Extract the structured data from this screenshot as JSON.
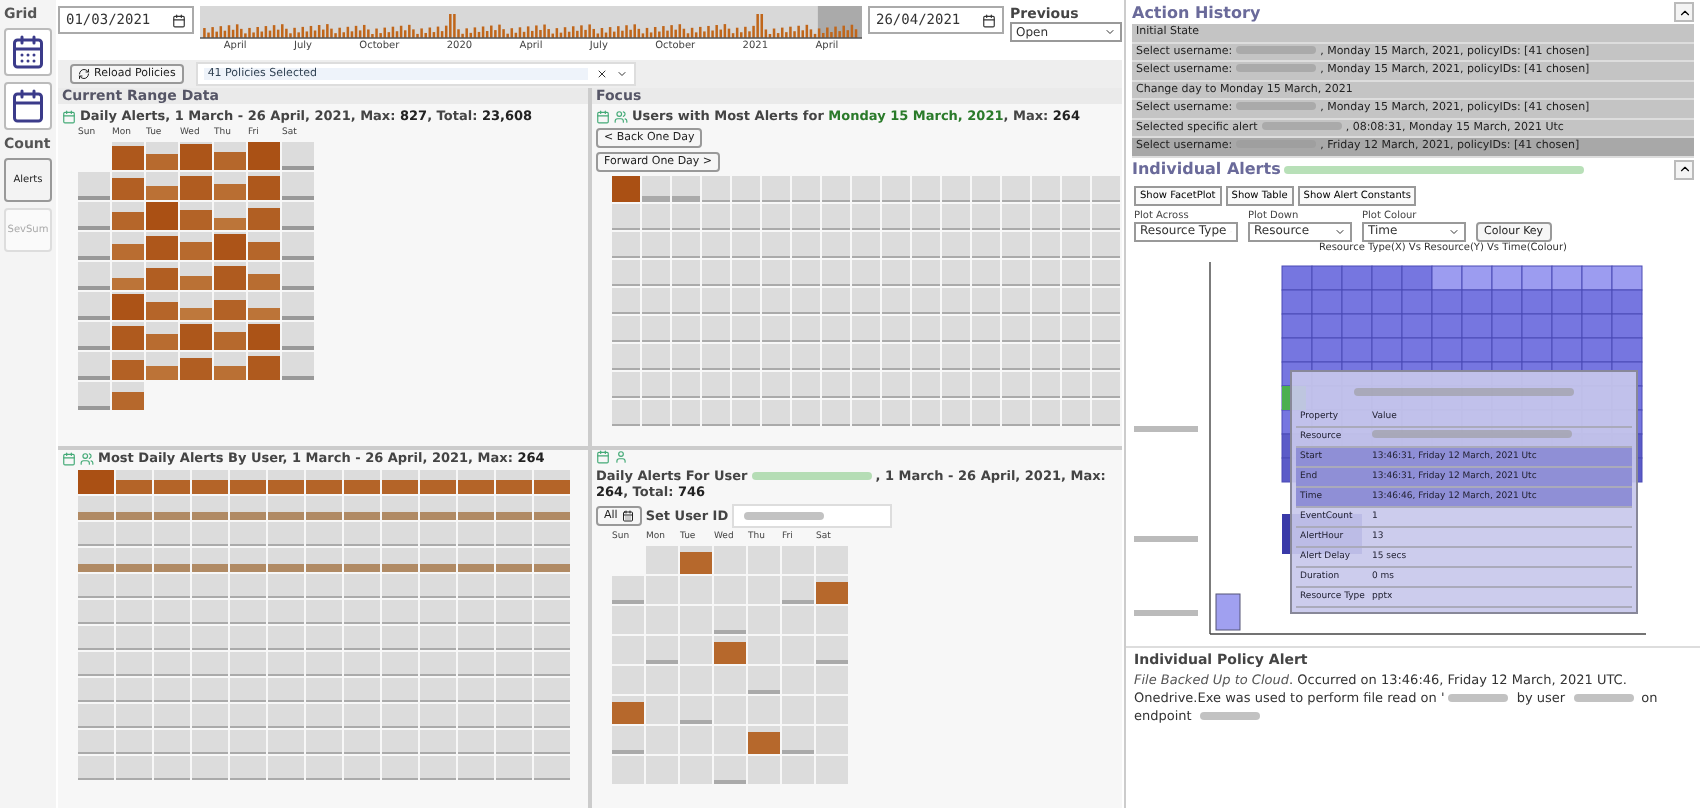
{
  "sidebar": {
    "grid_label": "Grid",
    "count_label": "Count",
    "buttons": [
      {
        "label": "Alerts",
        "selected": true
      },
      {
        "label": "SevSum",
        "selected": false
      }
    ]
  },
  "toolbar": {
    "start_date": "01/03/2021",
    "end_date": "26/04/2021",
    "timeline_labels": [
      "April",
      "July",
      "October",
      "2020",
      "April",
      "July",
      "October",
      "2021",
      "April"
    ],
    "previous_label": "Previous",
    "previous_value": "Open",
    "reload_button": "Reload Policies",
    "policies": "41 Policies Selected"
  },
  "range_panel": {
    "section": "Current Range Data",
    "title": "Daily Alerts, 1 March - 26 April, 2021, Max: **827**, Total: **23,608**",
    "days": [
      "Sun",
      "Mon",
      "Tue",
      "Wed",
      "Thu",
      "Fri",
      "Sat"
    ]
  },
  "focus_panel": {
    "section": "Focus",
    "title_prefix": "Users with Most Alerts for ",
    "title_date": "Monday 15 March, 2021",
    "title_suffix": ", Max: **264**",
    "back_button": "< Back One Day",
    "forward_button": "Forward One Day >"
  },
  "user_panel": {
    "title": "Most Daily Alerts By User, 1 March - 26 April, 2021, Max: **264**"
  },
  "user_daily_panel": {
    "title_prefix": "Daily Alerts For User",
    "title_suffix": ", 1 March - 26 April, 2021, Max: **264**, Total: **746**",
    "all_button": "All",
    "set_user_label": "Set User ID",
    "days": [
      "Sun",
      "Mon",
      "Tue",
      "Wed",
      "Thu",
      "Fri",
      "Sat"
    ]
  },
  "action_history": {
    "title": "Action History",
    "items": [
      {
        "prefix": "Initial State",
        "redacted": false,
        "selected": false
      },
      {
        "prefix": "Select username:",
        "redacted": true,
        "suffix": ", Monday 15 March, 2021, policyIDs: [41 chosen]",
        "selected": false
      },
      {
        "prefix": "Select username:",
        "redacted": true,
        "suffix": ", Monday 15 March, 2021, policyIDs: [41 chosen]",
        "selected": false
      },
      {
        "prefix": "Change day to Monday 15 March, 2021",
        "redacted": false,
        "selected": false
      },
      {
        "prefix": "Select username:",
        "redacted": true,
        "suffix": ", Monday 15 March, 2021, policyIDs: [41 chosen]",
        "selected": false
      },
      {
        "prefix": "Selected specific alert",
        "redacted": true,
        "suffix": ", 08:08:31, Monday 15 March, 2021 Utc",
        "selected": false
      },
      {
        "prefix": "Select username:",
        "redacted": true,
        "suffix": ", Friday 12 March, 2021, policyIDs: [41 chosen]",
        "selected": true
      }
    ]
  },
  "individual_alerts": {
    "title": "Individual Alerts",
    "tabs": [
      "Show FacetPlot",
      "Show Table",
      "Show Alert Constants"
    ],
    "controls": [
      {
        "label": "Plot Across",
        "value": "Resource Type"
      },
      {
        "label": "Plot Down",
        "value": "Resource"
      },
      {
        "label": "Plot Colour",
        "value": "Time"
      }
    ],
    "colour_key_button": "Colour Key",
    "caption": "Resource Type(X) Vs Resource(Y) Vs Time(Colour)",
    "tooltip": {
      "headers": [
        "Property",
        "Value"
      ],
      "rows": [
        {
          "kind": "redacted",
          "property": "Resource",
          "highlighted": false
        },
        {
          "kind": "text",
          "property": "Start",
          "value": "13:46:31, Friday 12 March, 2021 Utc",
          "highlighted": true
        },
        {
          "kind": "text",
          "property": "End",
          "value": "13:46:31, Friday 12 March, 2021 Utc",
          "highlighted": true
        },
        {
          "kind": "text",
          "property": "Time",
          "value": "13:46:46, Friday 12 March, 2021 Utc",
          "highlighted": true
        },
        {
          "kind": "text",
          "property": "EventCount",
          "value": "1",
          "highlighted": false
        },
        {
          "kind": "text",
          "property": "AlertHour",
          "value": "13",
          "highlighted": false
        },
        {
          "kind": "text",
          "property": "Alert Delay",
          "value": "15 secs",
          "highlighted": false
        },
        {
          "kind": "text",
          "property": "Duration",
          "value": "0 ms",
          "highlighted": false
        },
        {
          "kind": "text",
          "property": "Resource Type",
          "value": "pptx",
          "highlighted": false
        }
      ]
    }
  },
  "policy_alert": {
    "title": "Individual Policy Alert",
    "segments": [
      {
        "kind": "italic",
        "text": "File Backed Up to Cloud"
      },
      {
        "kind": "text",
        "text": ". Occurred on 13:46:46, Friday 12 March, 2021 UTC. Onedrive.Exe was used to perform file read on '"
      },
      {
        "kind": "redacted"
      },
      {
        "kind": "text",
        "text": " by user "
      },
      {
        "kind": "redacted"
      },
      {
        "kind": "text",
        "text": " on endpoint "
      },
      {
        "kind": "redacted"
      }
    ]
  }
}
